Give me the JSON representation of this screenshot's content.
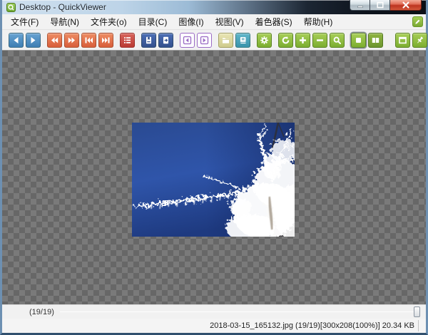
{
  "window": {
    "title": "Desktop - QuickViewer",
    "controls": {
      "minimize": "minimize",
      "maximize": "maximize",
      "close": "close"
    }
  },
  "menubar": {
    "items": [
      "文件(F)",
      "导航(N)",
      "文件夹(o)",
      "目录(C)",
      "图像(I)",
      "视图(V)",
      "着色器(S)",
      "帮助(H)"
    ],
    "quick_button_icon": "shader-edit-icon"
  },
  "toolbar": {
    "buttons": [
      {
        "icon": "prev-image-icon",
        "color": "#4e8fc4"
      },
      {
        "icon": "next-image-icon",
        "color": "#4e8fc4"
      },
      {
        "icon": "back-multi-icon",
        "color": "#e2714b"
      },
      {
        "icon": "forward-multi-icon",
        "color": "#e2714b"
      },
      {
        "icon": "first-image-icon",
        "color": "#e2714b"
      },
      {
        "icon": "last-image-icon",
        "color": "#e2714b"
      },
      {
        "icon": "playlist-icon",
        "color": "#c84a42"
      },
      {
        "icon": "open-archive-icon",
        "color": "#3d5fa6"
      },
      {
        "icon": "goto-page-icon",
        "color": "#3d5fa6"
      },
      {
        "icon": "prev-folder-icon",
        "color": "#9b6bc4"
      },
      {
        "icon": "next-folder-icon",
        "color": "#9b6bc4"
      },
      {
        "icon": "open-folder-icon",
        "color": "#d6d29a"
      },
      {
        "icon": "catalog-icon",
        "color": "#4aa4bc"
      },
      {
        "icon": "settings-gear-icon",
        "color": "#8cba3e"
      },
      {
        "icon": "refresh-icon",
        "color": "#8cba3e"
      },
      {
        "icon": "zoom-in-icon",
        "color": "#8cba3e"
      },
      {
        "icon": "zoom-out-icon",
        "color": "#8cba3e"
      },
      {
        "icon": "magnifier-icon",
        "color": "#8cba3e"
      },
      {
        "icon": "fit-window-icon",
        "color": "#8cba3e",
        "active": true
      },
      {
        "icon": "spread-view-icon",
        "color": "#7da937"
      },
      {
        "icon": "fullscreen-icon",
        "color": "#8cba3e"
      },
      {
        "icon": "pin-icon",
        "color": "#8cba3e"
      }
    ]
  },
  "viewer": {
    "photo_description": "Frost-covered tree branches against a deep blue sky",
    "checker_dark": "#676767",
    "checker_light": "#7a7a7a"
  },
  "pager": {
    "label": "(19/19)"
  },
  "statusbar": {
    "info": "2018-03-15_165132.jpg (19/19)[300x208(100%)] 20.34 KB"
  }
}
